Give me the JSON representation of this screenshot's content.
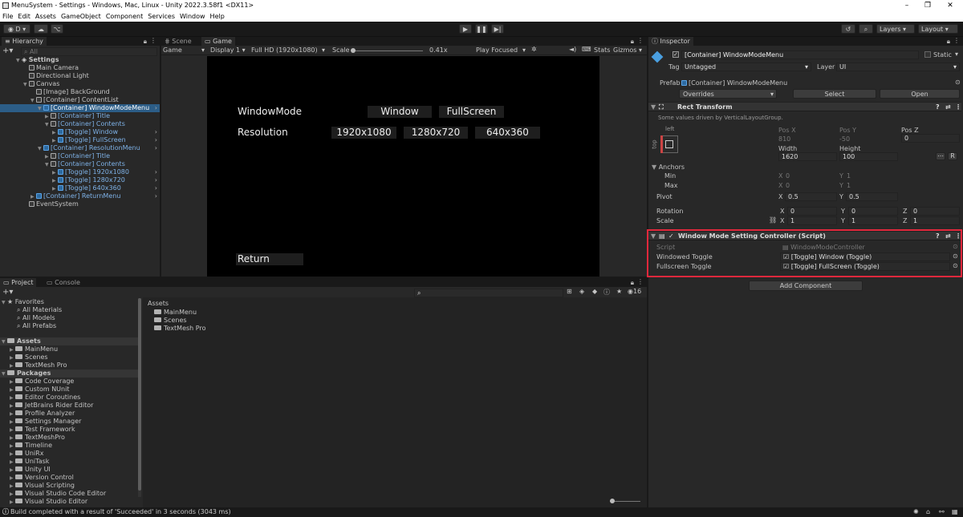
{
  "window": {
    "title": "MenuSystem - Settings - Windows, Mac, Linux - Unity 2022.3.58f1 <DX11>"
  },
  "menu": [
    "File",
    "Edit",
    "Assets",
    "GameObject",
    "Component",
    "Services",
    "Window",
    "Help"
  ],
  "toolbar": {
    "account": "D",
    "layers": "Layers",
    "layout": "Layout"
  },
  "hierarchy": {
    "tab": "Hierarchy",
    "search_placeholder": "All",
    "items": [
      {
        "label": "Settings",
        "depth": 0,
        "icon": "unity-scene-icon",
        "bold": true,
        "arrow": "▼"
      },
      {
        "label": "Main Camera",
        "depth": 1,
        "icon": "cube"
      },
      {
        "label": "Directional Light",
        "depth": 1,
        "icon": "cube"
      },
      {
        "label": "Canvas",
        "depth": 1,
        "icon": "cube",
        "arrow": "▼"
      },
      {
        "label": "[Image] BackGround",
        "depth": 2,
        "icon": "cube"
      },
      {
        "label": "[Container] ContentList",
        "depth": 2,
        "icon": "cube",
        "arrow": "▼"
      },
      {
        "label": "[Container] WindowModeMenu",
        "depth": 3,
        "icon": "prefab",
        "selected": true,
        "arrow": "▼",
        "chev": true
      },
      {
        "label": "[Container] Title",
        "depth": 4,
        "icon": "cube",
        "blue": true,
        "arrow": "▶"
      },
      {
        "label": "[Container] Contents",
        "depth": 4,
        "icon": "cube",
        "blue": true,
        "arrow": "▼"
      },
      {
        "label": "[Toggle] Window",
        "depth": 5,
        "icon": "prefab",
        "blue": true,
        "arrow": "▶",
        "chev": true
      },
      {
        "label": "[Toggle] FullScreen",
        "depth": 5,
        "icon": "prefab",
        "blue": true,
        "arrow": "▶",
        "chev": true
      },
      {
        "label": "[Container] ResolutionMenu",
        "depth": 3,
        "icon": "prefab",
        "blue": true,
        "arrow": "▼",
        "chev": true
      },
      {
        "label": "[Container] Title",
        "depth": 4,
        "icon": "cube",
        "blue": true,
        "arrow": "▶"
      },
      {
        "label": "[Container] Contents",
        "depth": 4,
        "icon": "cube",
        "blue": true,
        "arrow": "▼"
      },
      {
        "label": "[Toggle] 1920x1080",
        "depth": 5,
        "icon": "prefab",
        "blue": true,
        "arrow": "▶",
        "chev": true
      },
      {
        "label": "[Toggle] 1280x720",
        "depth": 5,
        "icon": "prefab",
        "blue": true,
        "arrow": "▶",
        "chev": true
      },
      {
        "label": "[Toggle] 640x360",
        "depth": 5,
        "icon": "prefab",
        "blue": true,
        "arrow": "▶",
        "chev": true
      },
      {
        "label": "[Container] ReturnMenu",
        "depth": 2,
        "icon": "prefab",
        "blue": true,
        "arrow": "▶",
        "chev": true
      },
      {
        "label": "EventSystem",
        "depth": 1,
        "icon": "cube"
      }
    ]
  },
  "game": {
    "tabs": {
      "scene": "Scene",
      "game": "Game"
    },
    "display_mode": "Game",
    "display": "Display 1",
    "resolution": "Full HD (1920x1080)",
    "scale_label": "Scale",
    "scale_value": "0.41x",
    "play_focused": "Play Focused",
    "stats": "Stats",
    "gizmos": "Gizmos",
    "window_mode_label": "WindowMode",
    "window_btn": "Window",
    "fullscreen_btn": "FullScreen",
    "resolution_label": "Resolution",
    "res1": "1920x1080",
    "res2": "1280x720",
    "res3": "640x360",
    "return_btn": "Return"
  },
  "inspector": {
    "tab": "Inspector",
    "object_name": "[Container] WindowModeMenu",
    "static_label": "Static",
    "tag_label": "Tag",
    "tag_value": "Untagged",
    "layer_label": "Layer",
    "layer_value": "UI",
    "prefab_label": "Prefab",
    "prefab_value": "[Container] WindowModeMenu",
    "overrides": "Overrides",
    "select": "Select",
    "open": "Open",
    "rect_transform": "Rect Transform",
    "driven_note": "Some values driven by VerticalLayoutGroup.",
    "anchor_h": "left",
    "anchor_v": "top",
    "pos_x_label": "Pos X",
    "pos_y_label": "Pos Y",
    "pos_z_label": "Pos Z",
    "pos_x": "810",
    "pos_y": "-50",
    "pos_z": "0",
    "width_label": "Width",
    "height_label": "Height",
    "width": "1620",
    "height": "100",
    "anchors_label": "Anchors",
    "min_label": "Min",
    "max_label": "Max",
    "min_x": "0",
    "min_y": "1",
    "max_x": "0",
    "max_y": "1",
    "pivot_label": "Pivot",
    "pivot_x": "0.5",
    "pivot_y": "0.5",
    "rotation_label": "Rotation",
    "rot_x": "0",
    "rot_y": "0",
    "rot_z": "0",
    "scale_label": "Scale",
    "scale_x": "1",
    "scale_y": "1",
    "scale_z": "1",
    "axis_x": "X",
    "axis_y": "Y",
    "axis_z": "Z",
    "blueprint": "R",
    "script_component": "Window Mode Setting Controller (Script)",
    "script_label": "Script",
    "script_value": "WindowModeController",
    "windowed_label": "Windowed Toggle",
    "windowed_value": "[Toggle] Window (Toggle)",
    "fullscreen_label": "Fullscreen Toggle",
    "fullscreen_value": "[Toggle] FullScreen (Toggle)",
    "add_component": "Add Component",
    "highlight_color": "#e0283c"
  },
  "project": {
    "tabs": {
      "project": "Project",
      "console": "Console"
    },
    "favorites_label": "Favorites",
    "favorites": [
      "All Materials",
      "All Models",
      "All Prefabs"
    ],
    "assets_label": "Assets",
    "assets": [
      "MainMenu",
      "Scenes",
      "TextMesh Pro"
    ],
    "packages_label": "Packages",
    "packages": [
      "Code Coverage",
      "Custom NUnit",
      "Editor Coroutines",
      "JetBrains Rider Editor",
      "Profile Analyzer",
      "Settings Manager",
      "Test Framework",
      "TextMeshPro",
      "Timeline",
      "UniRx",
      "UniTask",
      "Unity UI",
      "Version Control",
      "Visual Scripting",
      "Visual Studio Code Editor",
      "Visual Studio Editor"
    ],
    "breadcrumb": "Assets",
    "right_items": [
      "MainMenu",
      "Scenes",
      "TextMesh Pro"
    ],
    "badge_count": "16"
  },
  "status": {
    "message": "Build completed with a result of 'Succeeded' in 3 seconds (3043 ms)"
  }
}
